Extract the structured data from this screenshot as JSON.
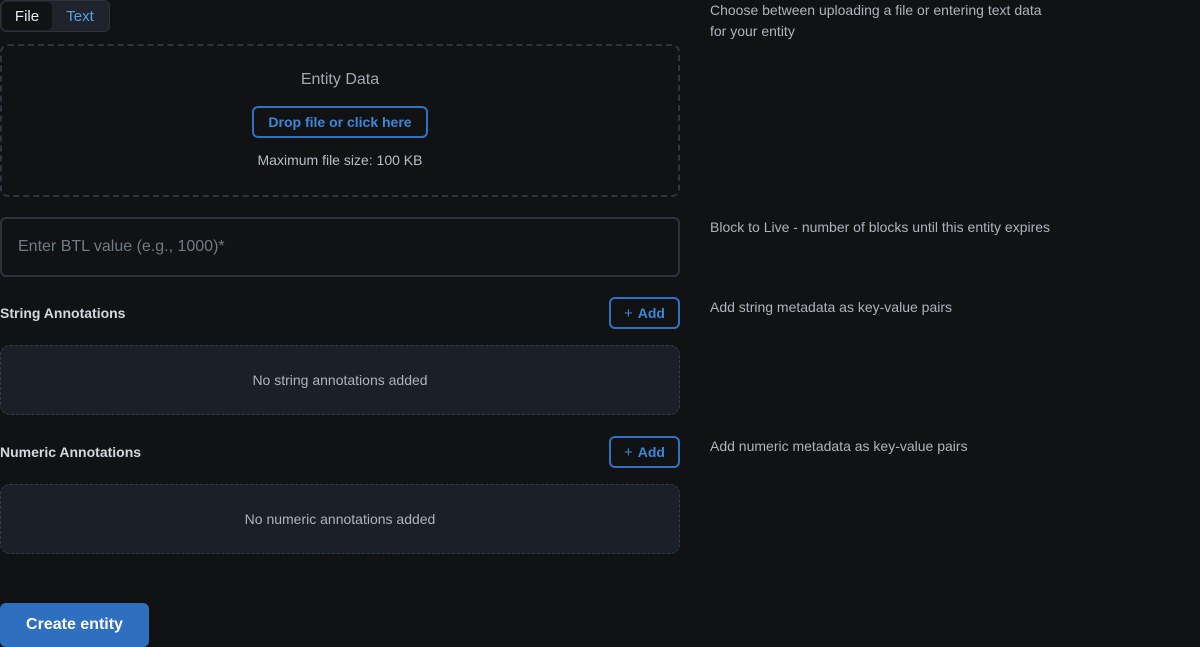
{
  "tabs": {
    "file_label": "File",
    "text_label": "Text",
    "selected": "File"
  },
  "entity_data": {
    "title": "Entity Data",
    "upload_button": "Drop file or click here",
    "max_size": "Maximum file size: 100 KB",
    "help": "Choose between uploading a file or entering text data for your entity"
  },
  "btl": {
    "placeholder": "Enter BTL value (e.g., 1000)*",
    "value": "",
    "help": "Block to Live - number of blocks until this entity expires"
  },
  "string_annotations": {
    "title": "String Annotations",
    "add_label": "Add",
    "empty_text": "No string annotations added",
    "help": "Add string metadata as key-value pairs"
  },
  "numeric_annotations": {
    "title": "Numeric Annotations",
    "add_label": "Add",
    "empty_text": "No numeric annotations added",
    "help": "Add numeric metadata as key-value pairs"
  },
  "submit": {
    "label": "Create entity"
  },
  "icons": {
    "add": "plus-icon"
  },
  "colors": {
    "background": "#111214",
    "accent": "#2f6fbf",
    "accent_text": "#3b87da"
  }
}
